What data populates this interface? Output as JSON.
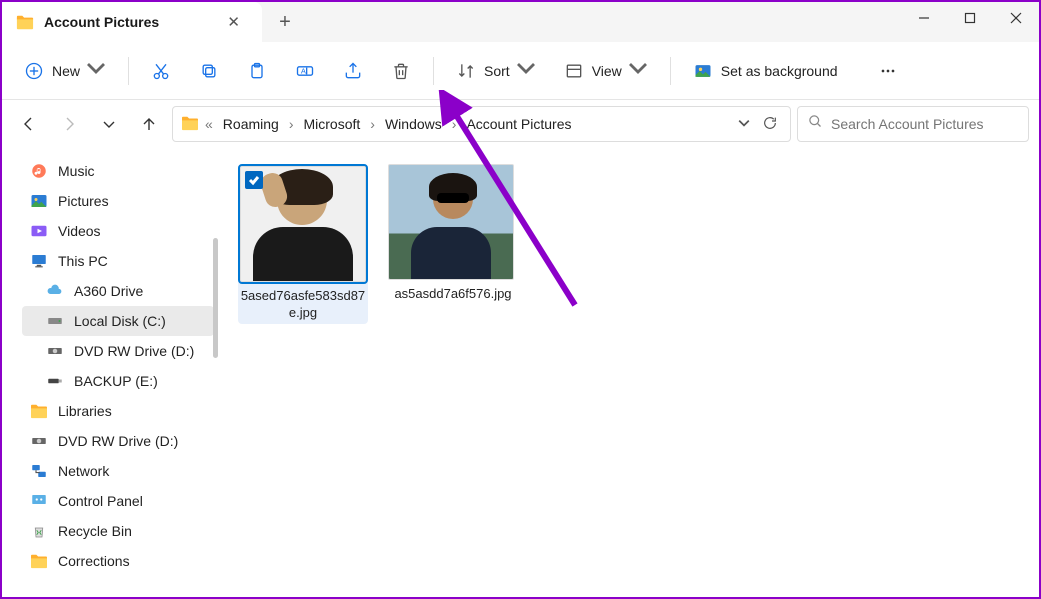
{
  "tab": {
    "title": "Account Pictures"
  },
  "toolbar": {
    "new": "New",
    "sort": "Sort",
    "view": "View",
    "set_bg": "Set as background"
  },
  "breadcrumb": {
    "prefix": "«",
    "segments": [
      "Roaming",
      "Microsoft",
      "Windows",
      "Account Pictures"
    ]
  },
  "search": {
    "placeholder": "Search Account Pictures"
  },
  "sidebar": [
    {
      "label": "Music",
      "icon": "music",
      "indent": false
    },
    {
      "label": "Pictures",
      "icon": "pictures",
      "indent": false
    },
    {
      "label": "Videos",
      "icon": "videos",
      "indent": false
    },
    {
      "label": "This PC",
      "icon": "thispc",
      "indent": false
    },
    {
      "label": "A360 Drive",
      "icon": "cloud",
      "indent": true
    },
    {
      "label": "Local Disk (C:)",
      "icon": "drive",
      "indent": true,
      "selected": true
    },
    {
      "label": "DVD RW Drive (D:)",
      "icon": "dvd",
      "indent": true
    },
    {
      "label": "BACKUP (E:)",
      "icon": "usb",
      "indent": true
    },
    {
      "label": "Libraries",
      "icon": "folder",
      "indent": false
    },
    {
      "label": "DVD RW Drive (D:)",
      "icon": "dvd",
      "indent": false
    },
    {
      "label": "Network",
      "icon": "network",
      "indent": false
    },
    {
      "label": "Control Panel",
      "icon": "control",
      "indent": false
    },
    {
      "label": "Recycle Bin",
      "icon": "recycle",
      "indent": false
    },
    {
      "label": "Corrections",
      "icon": "folder",
      "indent": false
    }
  ],
  "files": [
    {
      "name": "5ased76asfe583sd87e.jpg",
      "selected": true
    },
    {
      "name": "as5asdd7a6f576.jpg",
      "selected": false
    }
  ]
}
